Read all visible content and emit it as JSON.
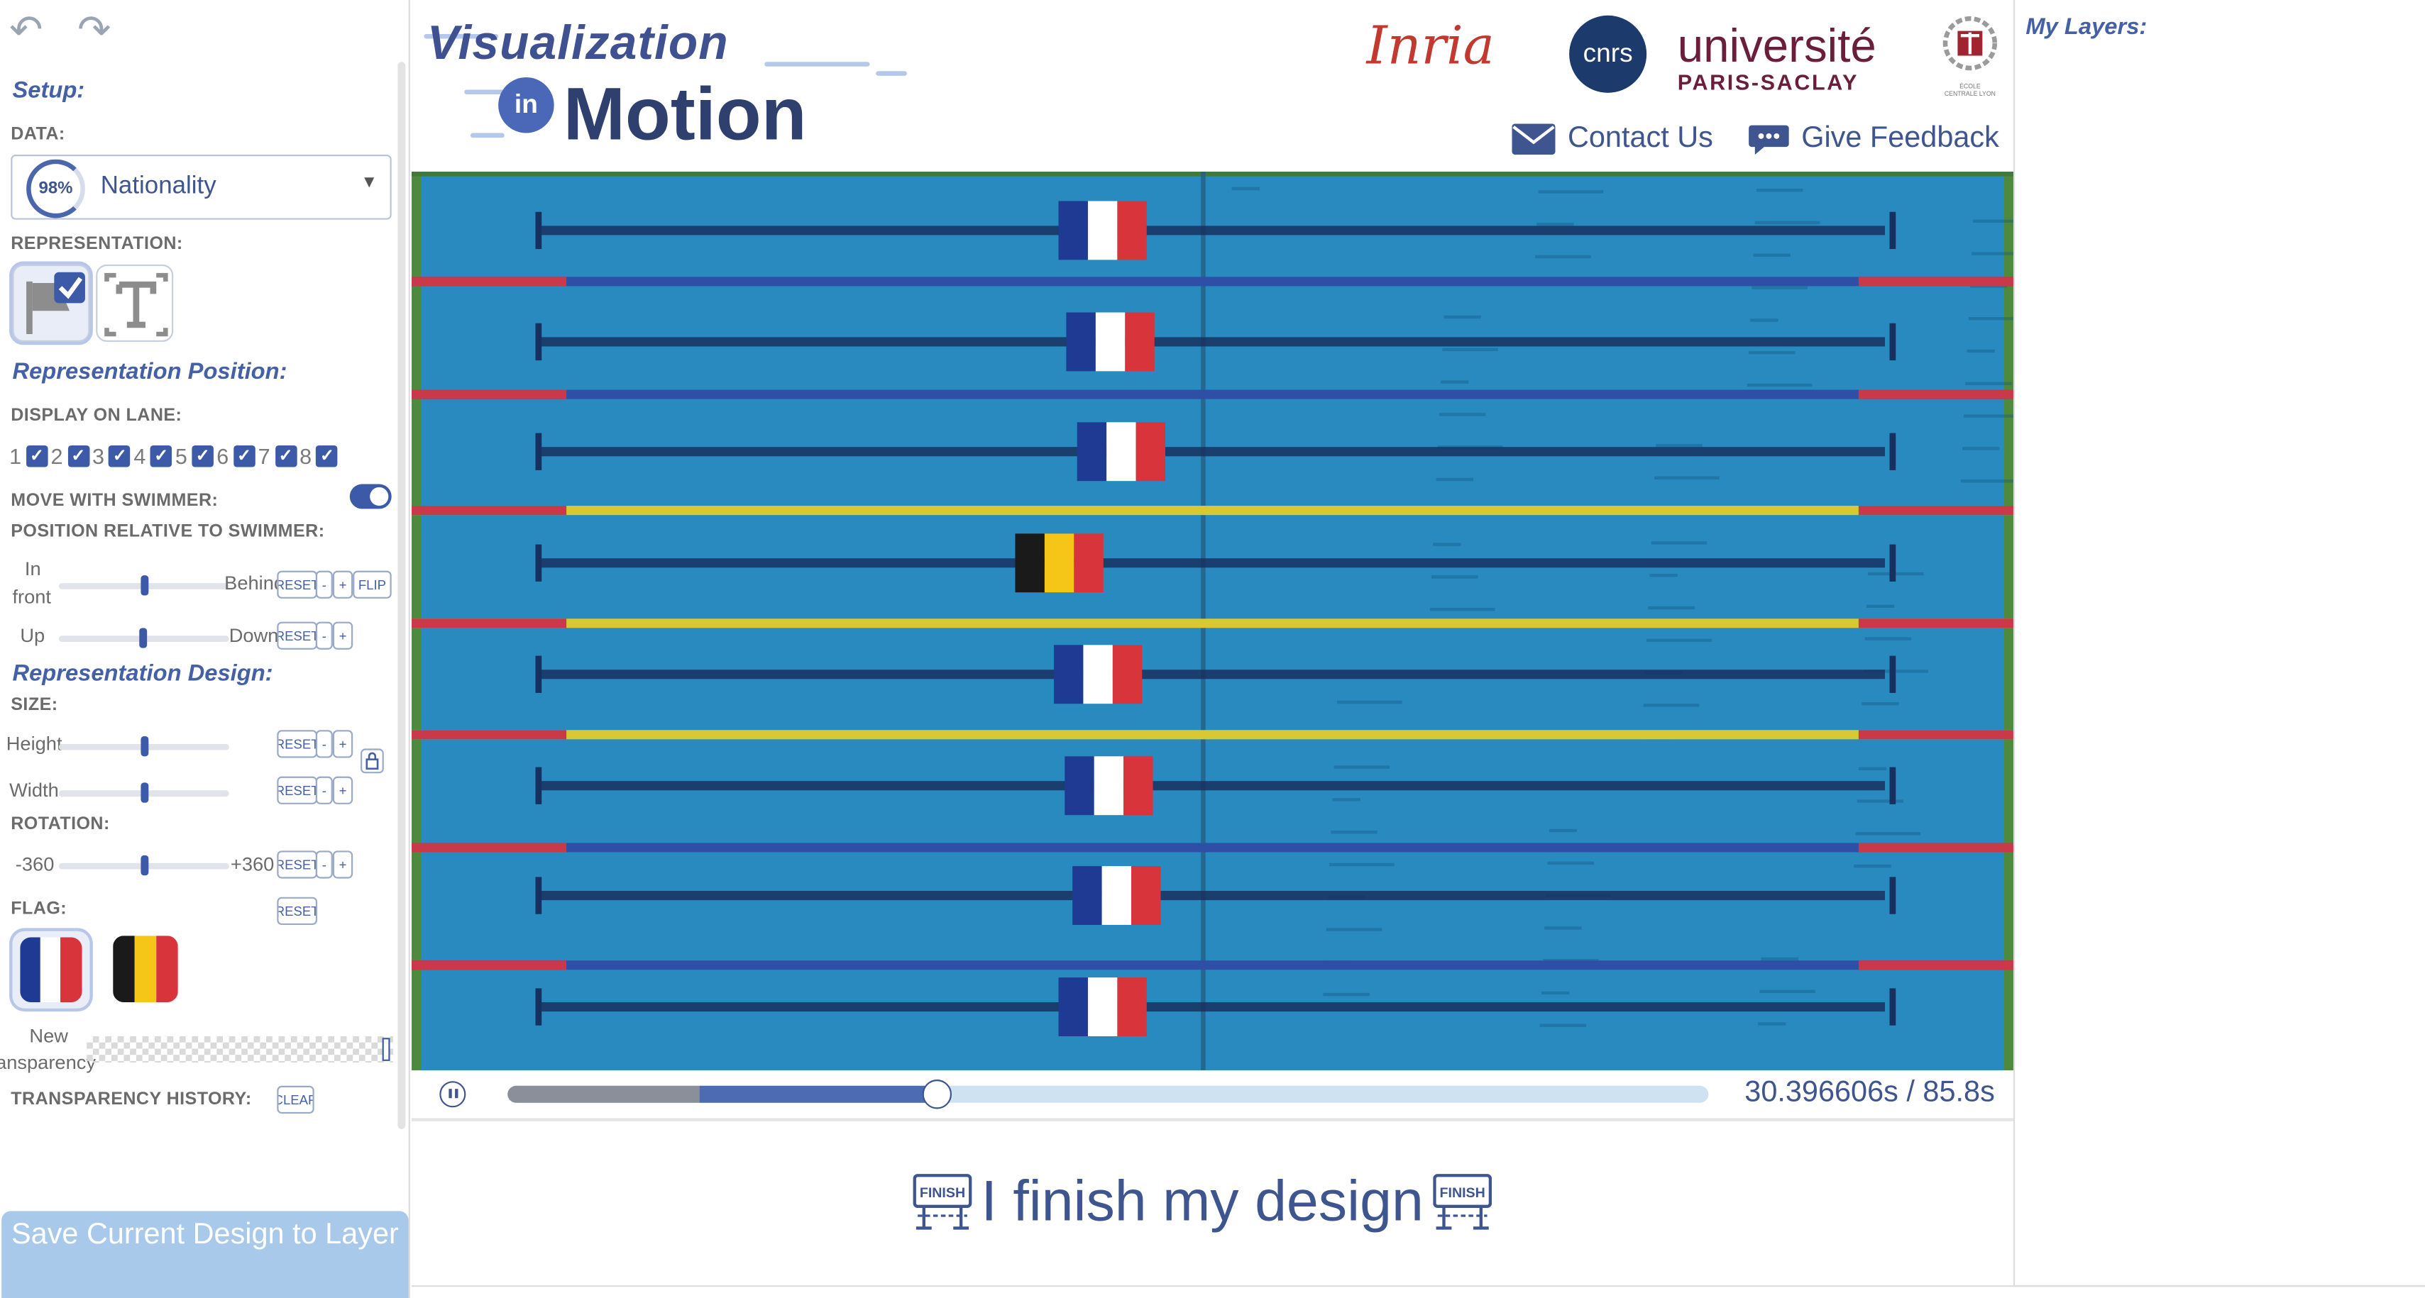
{
  "sidebar": {
    "undo_icon": "undo-icon",
    "redo_icon": "redo-icon",
    "setup_heading": "Setup:",
    "data_label": "DATA:",
    "data_select": {
      "percent": "98%",
      "value": "Nationality"
    },
    "representation_label": "REPRESENTATION:",
    "representation_options": [
      {
        "icon": "flag-icon",
        "selected": true
      },
      {
        "icon": "text-icon",
        "selected": false
      }
    ],
    "rep_position_heading": "Representation Position:",
    "display_on_lane_label": "DISPLAY ON LANE:",
    "lanes": [
      "1",
      "2",
      "3",
      "4",
      "5",
      "6",
      "7",
      "8"
    ],
    "lanes_checked": [
      true,
      true,
      true,
      true,
      true,
      true,
      true,
      true
    ],
    "move_with_swimmer_label": "MOVE WITH SWIMMER:",
    "move_with_swimmer_on": true,
    "position_relative_label": "POSITION RELATIVE TO SWIMMER:",
    "front_behind": {
      "left_line1": "In",
      "left_line2": "front",
      "right": "Behind",
      "reset": "RESET",
      "minus": "-",
      "plus": "+",
      "flip": "FLIP"
    },
    "up_down": {
      "left": "Up",
      "right": "Down",
      "reset": "RESET",
      "minus": "-",
      "plus": "+"
    },
    "rep_design_heading": "Representation Design:",
    "size_label": "SIZE:",
    "height": {
      "label": "Height",
      "reset": "RESET",
      "minus": "-",
      "plus": "+"
    },
    "width": {
      "label": "Width",
      "reset": "RESET",
      "minus": "-",
      "plus": "+"
    },
    "lock_icon": "lock-icon",
    "rotation_label": "ROTATION:",
    "rotation": {
      "min": "-360",
      "max": "+360",
      "reset": "RESET",
      "minus": "-",
      "plus": "+"
    },
    "flag_label": "FLAG:",
    "flag_reset": "RESET",
    "flags": [
      {
        "name": "france",
        "colors": [
          "#1f3a93",
          "#ffffff",
          "#d8343c"
        ],
        "selected": true
      },
      {
        "name": "belgium",
        "colors": [
          "#1a1a1a",
          "#f5c518",
          "#d8343c"
        ],
        "selected": false
      }
    ],
    "transparency_line1": "New",
    "transparency_line2": "transparency",
    "transparency_history_label": "TRANSPARENCY HISTORY:",
    "clear_label": "CLEAR",
    "save_button": "Save Current Design to Layer"
  },
  "header": {
    "logo_line1": "Visualization",
    "logo_in": "in",
    "logo_line2": "Motion",
    "partner_inria": "Inria",
    "partner_cnrs": "cnrs",
    "partner_univ_line1": "université",
    "partner_univ_line2": "PARIS-SACLAY",
    "partner_ecole_line1": "ÉCOLE",
    "partner_ecole_line2": "CENTRALE LYON",
    "contact_label": "Contact Us",
    "feedback_label": "Give Feedback"
  },
  "video": {
    "lane_flags": [
      "france",
      "france",
      "france",
      "belgium",
      "france",
      "france",
      "france",
      "france"
    ],
    "current_time": "30.396606s",
    "duration": "85.8s",
    "time_separator": " / ",
    "played_fraction": 0.357,
    "buffered_fraction": 0.16
  },
  "finish": {
    "label": "I finish my design",
    "badge": "FINISH"
  },
  "right_panel": {
    "title": "My Layers:"
  },
  "colors": {
    "accent": "#3d5aa8",
    "text": "#3e5590",
    "save_button": "#a9c9ea"
  }
}
